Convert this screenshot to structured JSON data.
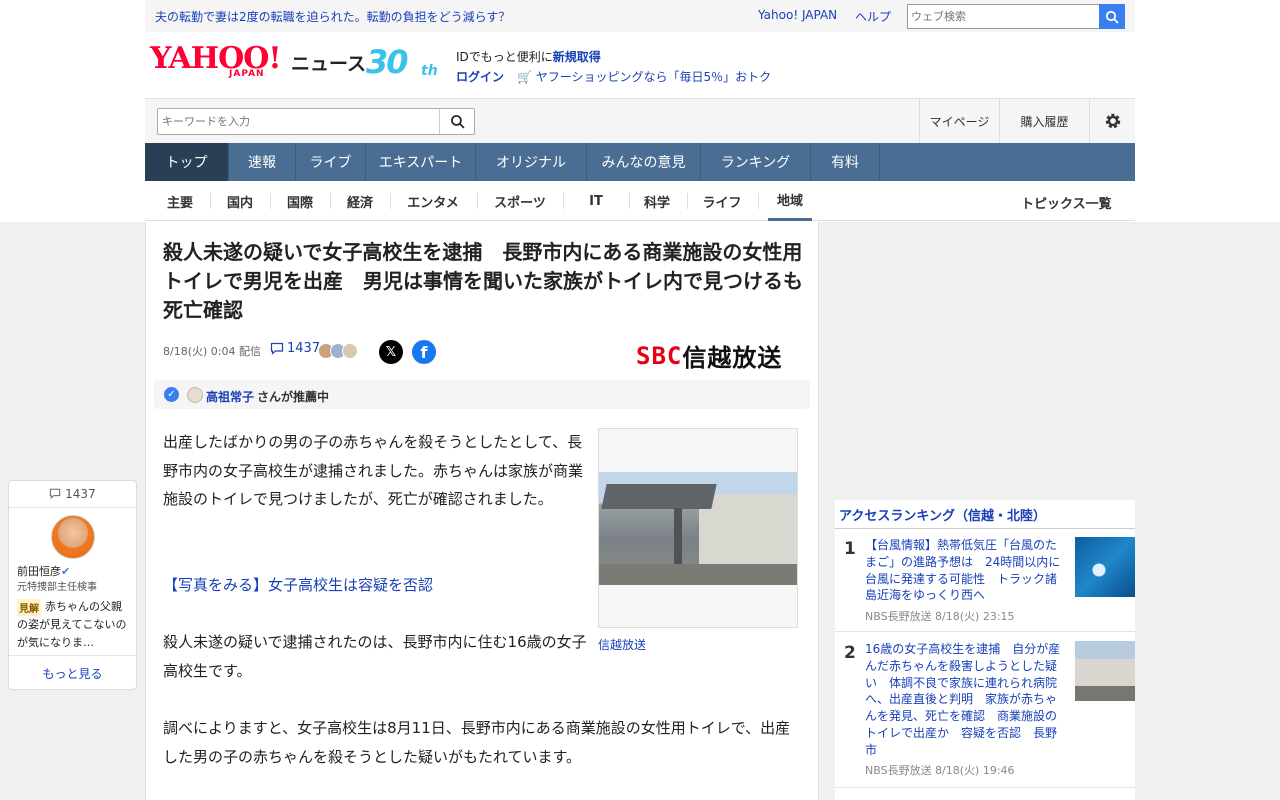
{
  "announce": {
    "text": "夫の転勤で妻は2度の転職を迫られた。転勤の負担をどう減らす？",
    "yahoo_japan": "Yahoo! JAPAN",
    "help": "ヘルプ",
    "web_search_placeholder": "ウェブ検索"
  },
  "brand": {
    "logo": "YAHOO!",
    "logo_sub": "JAPAN",
    "news": "ニュース",
    "anniv_num": "30",
    "anniv_suffix": "th"
  },
  "account": {
    "id_text": "IDでもっと便利に",
    "signup": "新規取得",
    "login": "ログイン",
    "shopping": "ヤフーショッピングなら「毎日5％」おトク"
  },
  "search": {
    "placeholder": "キーワードを入力",
    "mypage": "マイページ",
    "history": "購入履歴"
  },
  "main_nav": [
    "トップ",
    "速報",
    "ライブ",
    "エキスパート",
    "オリジナル",
    "みんなの意見",
    "ランキング",
    "有料"
  ],
  "sub_nav": [
    "主要",
    "国内",
    "国際",
    "経済",
    "エンタメ",
    "スポーツ",
    "IT",
    "科学",
    "ライフ",
    "地域"
  ],
  "topics_link": "トピックス一覧",
  "article": {
    "headline": "殺人未遂の疑いで女子高校生を逮捕　長野市内にある商業施設の女性用トイレで男児を出産　男児は事情を聞いた家族がトイレ内で見つけるも死亡確認",
    "date": "8/18(火) 0:04 配信",
    "comment_count": "1437",
    "publisher_mark": "SBC",
    "publisher_name": "信越放送",
    "recommended_by": "高祖常子",
    "recommended_suffix": "さんが推薦中",
    "paragraph1": "出産したばかりの男の子の赤ちゃんを殺そうとしたとして、長野市内の女子高校生が逮捕されました。赤ちゃんは家族が商業施設のトイレで見つけましたが、死亡が確認されました。",
    "photo_link": "【写真をみる】女子高校生は容疑を否認",
    "paragraph2": "殺人未遂の疑いで逮捕されたのは、長野市内に住む16歳の女子高校生です。",
    "paragraph3": "調べによりますと、女子高校生は8月11日、長野市内にある商業施設の女性用トイレで、出産した男の子の赤ちゃんを殺そうとした疑いがもたれています。",
    "photo_credit": "信越放送"
  },
  "comment_panel": {
    "count": "1437",
    "name": "前田恒彦",
    "title": "元特捜部主任検事",
    "badge": "見解",
    "text": "赤ちゃんの父親の姿が見えてこないのが気になりま…",
    "more": "もっと見る"
  },
  "ranking": {
    "title": "アクセスランキング（信越・北陸）",
    "items": [
      {
        "rank": "1",
        "text": "【台風情報】熱帯低気圧「台風のたまご」の進路予想は　24時間以内に台風に発達する可能性　トラック諸島近海をゆっくり西へ",
        "meta": "NBS長野放送 8/18(火) 23:15"
      },
      {
        "rank": "2",
        "text": "16歳の女子高校生を逮捕　自分が産んだ赤ちゃんを殺害しようとした疑い　体調不良で家族に連れられ病院へ、出産直後と判明　家族が赤ちゃんを発見、死亡を確認　商業施設のトイレで出産か　容疑を否認　長野市",
        "meta": "NBS長野放送 8/18(火) 19:46"
      }
    ]
  }
}
